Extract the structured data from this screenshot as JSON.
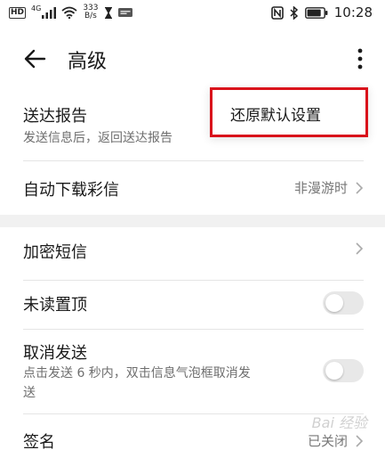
{
  "status_bar": {
    "hd": "HD",
    "signal_type": "4G",
    "net_speed_value": "333",
    "net_speed_unit": "B/s",
    "time": "10:28",
    "battery_level": "0.85"
  },
  "header": {
    "title": "高级"
  },
  "popup_menu": {
    "items": [
      {
        "label": "还原默认设置"
      }
    ]
  },
  "settings": {
    "delivery_report": {
      "title": "送达报告",
      "subtitle": "发送信息后，返回送达报告"
    },
    "auto_download_mms": {
      "title": "自动下载彩信",
      "value": "非漫游时"
    },
    "encrypt_sms": {
      "title": "加密短信"
    },
    "pin_unread": {
      "title": "未读置顶",
      "enabled": false
    },
    "cancel_send": {
      "title": "取消发送",
      "subtitle_line1": "点击发送 6 秒内，双击信息气泡框取消发",
      "subtitle_line2": "送",
      "enabled": false
    },
    "signature": {
      "title": "签名",
      "value": "已关闭"
    }
  },
  "colors": {
    "highlight_border": "#d9121b",
    "toggle_off": "#e8e8e8",
    "secondary_text": "#6e6e6e"
  },
  "watermark": "Bai 经验"
}
